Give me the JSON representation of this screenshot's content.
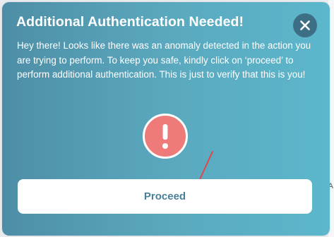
{
  "dialog": {
    "title": "Additional Authentication Needed!",
    "message": "Hey there! Looks like there was an anomaly detected in the action you are trying to perform. To keep you safe, kindly click on ‘proceed’ to perform additional authentication. This is just to verify that this is you!",
    "close_icon": "close-icon",
    "alert_icon": "exclamation-circle-icon",
    "proceed_label": "Proceed"
  },
  "colors": {
    "gradient_start": "#4d8ea6",
    "gradient_end": "#5cb7cc",
    "close_button": "#3c6f86",
    "alert_circle": "#ef7a7a",
    "annotation_arrow": "#e0474c",
    "button_text": "#4a7f99"
  }
}
